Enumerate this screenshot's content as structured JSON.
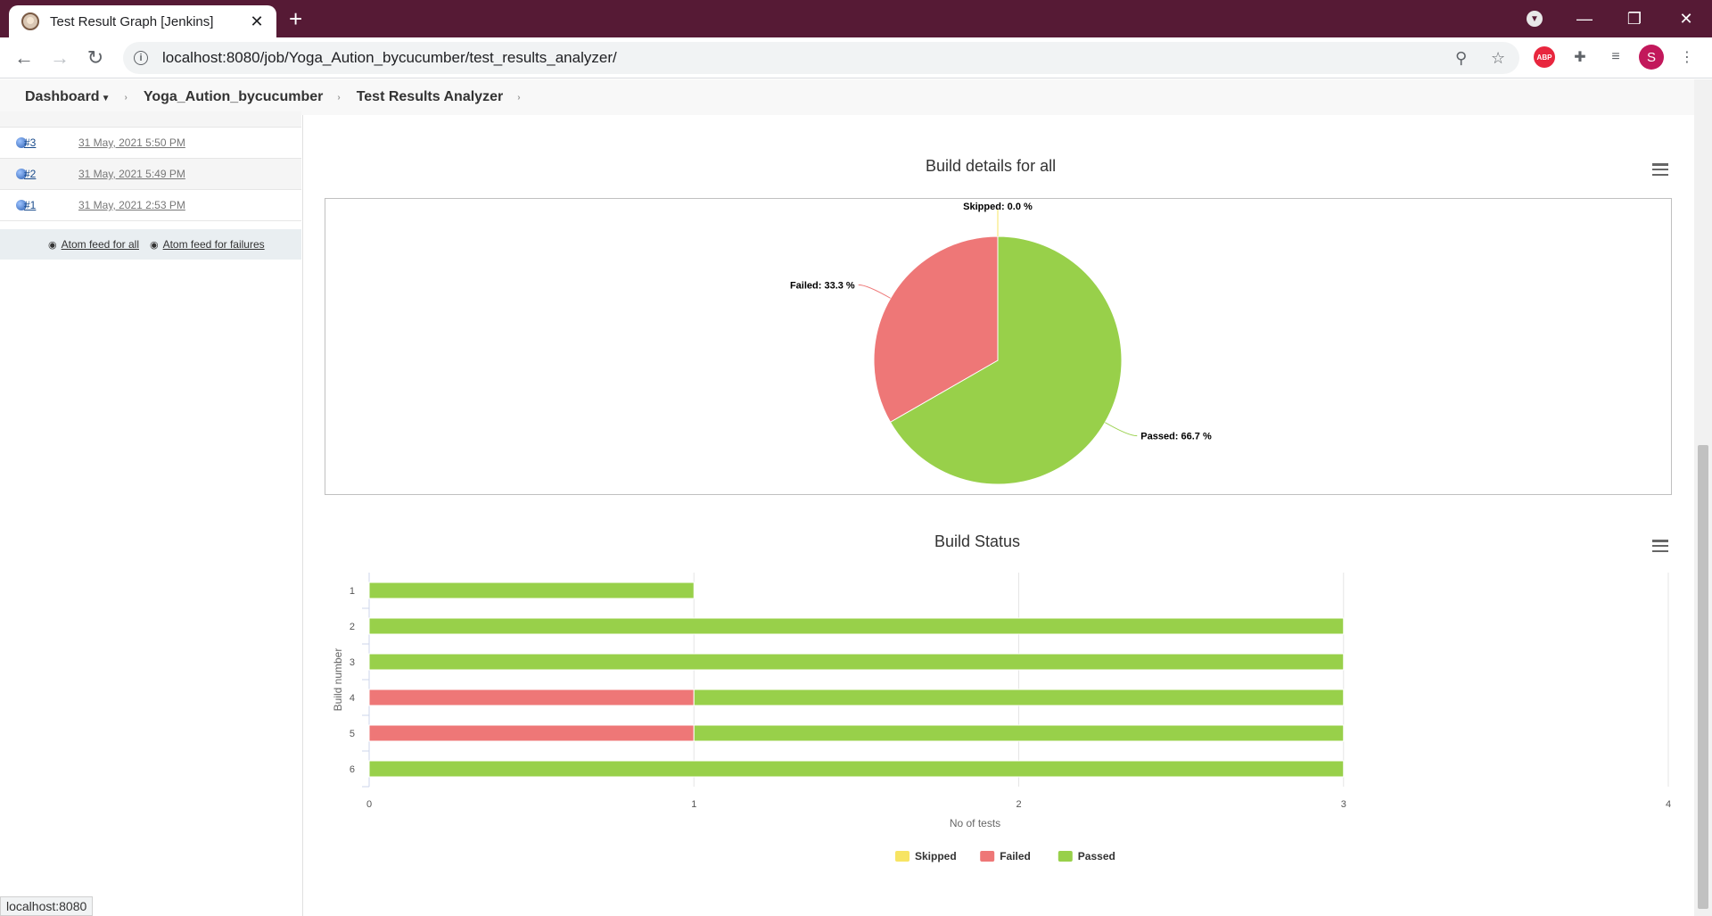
{
  "browser": {
    "tab_title": "Test Result Graph [Jenkins]",
    "url": "localhost:8080/job/Yoga_Aution_bycucumber/test_results_analyzer/",
    "profile_initial": "S",
    "status_url": "localhost:8080",
    "abp_label": "ABP"
  },
  "breadcrumb": {
    "dashboard": "Dashboard",
    "job": "Yoga_Aution_bycucumber",
    "page": "Test Results Analyzer"
  },
  "builds": [
    {
      "number": "#3",
      "date": "31 May, 2021 5:50 PM"
    },
    {
      "number": "#2",
      "date": "31 May, 2021 5:49 PM"
    },
    {
      "number": "#1",
      "date": "31 May, 2021 2:53 PM"
    }
  ],
  "feeds": {
    "all": "Atom feed for all",
    "failures": "Atom feed for failures"
  },
  "chart_data": [
    {
      "type": "pie",
      "title": "Build details for all",
      "slices": [
        {
          "name": "Passed",
          "value": 66.7,
          "label": "Passed: 66.7 %",
          "color": "#98d04a"
        },
        {
          "name": "Failed",
          "value": 33.3,
          "label": "Failed: 33.3 %",
          "color": "#ee7777"
        },
        {
          "name": "Skipped",
          "value": 0.0,
          "label": "Skipped: 0.0 %",
          "color": "#f7e463"
        }
      ]
    },
    {
      "type": "bar",
      "orientation": "horizontal",
      "stacked": true,
      "title": "Build Status",
      "xlabel": "No of tests",
      "ylabel": "Build number",
      "categories": [
        "1",
        "2",
        "3",
        "4",
        "5",
        "6"
      ],
      "xlim": [
        0,
        4
      ],
      "xticks": [
        "0",
        "1",
        "2",
        "3",
        "4"
      ],
      "grid": true,
      "legend_position": "bottom",
      "series": [
        {
          "name": "Skipped",
          "color": "#f7e463",
          "values": [
            0,
            0,
            0,
            0,
            0,
            0
          ]
        },
        {
          "name": "Failed",
          "color": "#ee7777",
          "values": [
            0,
            0,
            0,
            1,
            1,
            0
          ]
        },
        {
          "name": "Passed",
          "color": "#98d04a",
          "values": [
            1,
            3,
            3,
            2,
            2,
            3
          ]
        }
      ]
    }
  ]
}
